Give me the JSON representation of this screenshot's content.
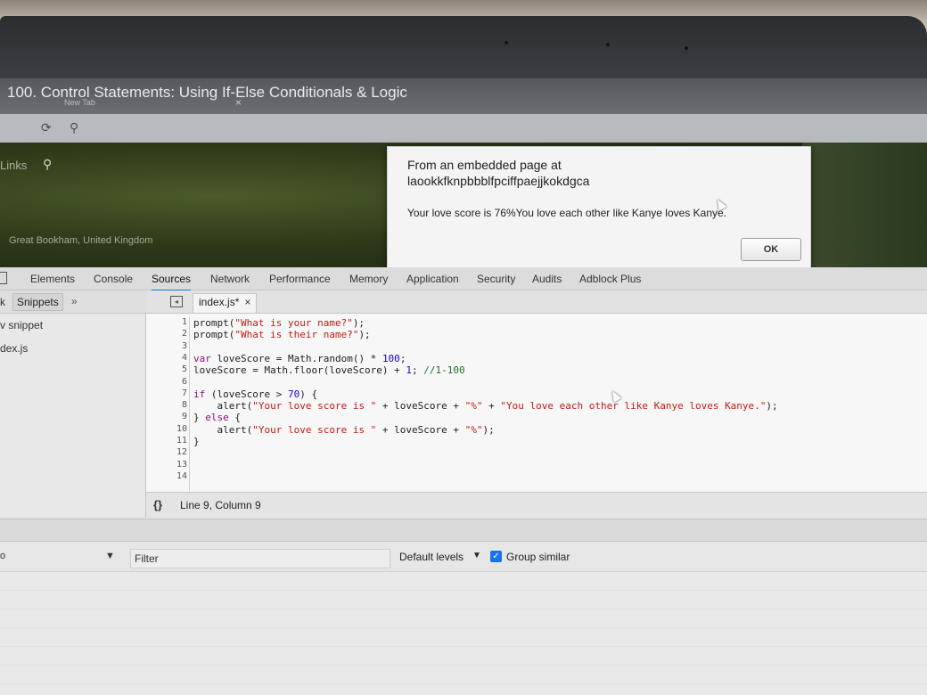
{
  "window": {
    "title": "100. Control Statements: Using If-Else Conditionals & Logic",
    "tab_title": "New Tab",
    "tab_close": "×",
    "reload_icon": "reload-icon",
    "search_icon": "search-icon"
  },
  "page": {
    "links_label": "Links",
    "location": "Great Bookham, United Kingdom"
  },
  "dialog": {
    "line1": "From an embedded page at",
    "line2": "laookkfknpbbblfpciffpaejjkokdgca",
    "message": "Your love score is 76%You love each other like Kanye loves Kanye.",
    "ok_label": "OK"
  },
  "devtools": {
    "tabs": [
      "Elements",
      "Console",
      "Sources",
      "Network",
      "Performance",
      "Memory",
      "Application",
      "Security",
      "Audits",
      "Adblock Plus"
    ],
    "active_tab": "Sources",
    "navigator": {
      "tab_partial": "k",
      "snippets_label": "Snippets",
      "more": "»",
      "menu": "⋮",
      "new_snippet": "v snippet",
      "file": "dex.js"
    },
    "editor": {
      "file_tab": "index.js*",
      "close": "×",
      "line_numbers": [
        "1",
        "2",
        "3",
        "4",
        "5",
        "6",
        "7",
        "8",
        "9",
        "10",
        "11",
        "12",
        "13",
        "14"
      ],
      "status": "Line 9, Column 9",
      "pretty_print": "{}"
    },
    "console": {
      "context_partial": "o",
      "filter_placeholder": "Filter",
      "levels_label": "Default levels",
      "levels_arrow": "▼",
      "context_arrow": "▼",
      "group_label": "Group similar",
      "group_checked": true
    }
  },
  "colors": {
    "accent": "#1a73e8",
    "keyword": "#881280",
    "string": "#c41a16",
    "number": "#1c00cf",
    "comment": "#236e25"
  }
}
